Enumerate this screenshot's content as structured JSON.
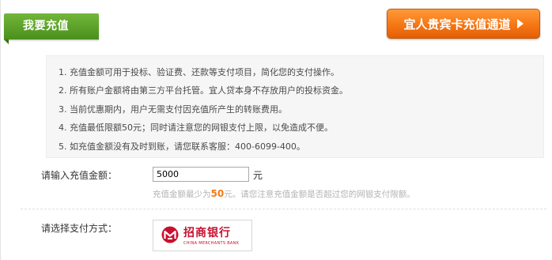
{
  "section": {
    "title": "我要充值"
  },
  "vip_button": {
    "label": "宜人贵宾卡充值通道"
  },
  "notices": [
    "1. 充值金额可用于投标、验证费、还款等支付项目，简化您的支付操作。",
    "2. 所有账户金额将由第三方平台托管。宜人贷本身不存放用户的投标资金。",
    "3. 当前优惠期内，用户无需支付因充值所产生的转账费用。",
    "4. 充值最低限额50元；同时请注意您的网银支付上限，以免造成不便。",
    "5. 如充值金额没有及时到账，请您联系客服：400-6099-400。"
  ],
  "amount": {
    "label": "请输入充值金额：",
    "value": "5000",
    "unit": "元",
    "hint_prefix": "充值金额最少为",
    "hint_min": "50",
    "hint_suffix": "元。请您注意充值金额是否超过您的网银支付限额。"
  },
  "payment": {
    "label": "请选择支付方式：",
    "bank_name": "招商银行",
    "bank_name_en": "CHINA MERCHANTS BANK"
  },
  "colors": {
    "tab_green": "#5aa02a",
    "button_orange": "#f57614",
    "hint_accent": "#f27c15",
    "bank_red": "#c8102e"
  },
  "icons": {
    "vip_arrow": "triangle-right-icon",
    "bank_logo": "cmb-logo-icon"
  }
}
